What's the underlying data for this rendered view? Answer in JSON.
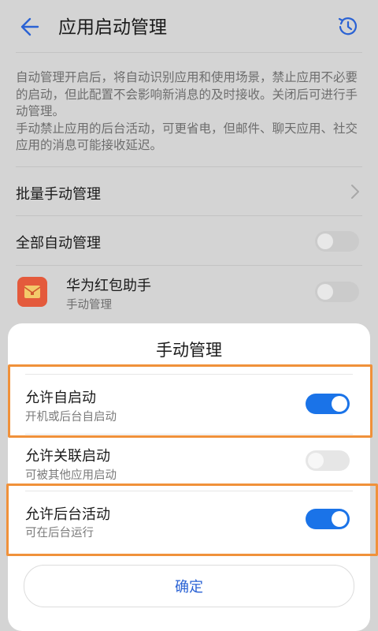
{
  "header": {
    "title": "应用启动管理",
    "back_icon": "back-arrow-icon",
    "history_icon": "history-clock-icon",
    "accent": "#2a62d4"
  },
  "description": {
    "paragraph1": "自动管理开启后，将自动识别应用和使用场景，禁止应用不必要的启动，但此配置不会影响新消息的及时接收。关闭后可进行手动管理。",
    "paragraph2": "手动禁止应用的后台活动，可更省电，但邮件、聊天应用、社交应用的消息可能接收延迟。"
  },
  "list": {
    "batch_manual": "批量手动管理",
    "auto_all": {
      "label": "全部自动管理",
      "on": false
    },
    "app": {
      "name": "华为红包助手",
      "status": "手动管理",
      "on": false,
      "icon": "red-envelope-icon"
    }
  },
  "sheet": {
    "title": "手动管理",
    "options": [
      {
        "title": "允许自启动",
        "subtitle": "开机或后台自启动",
        "on": true,
        "highlighted": true
      },
      {
        "title": "允许关联启动",
        "subtitle": "可被其他应用启动",
        "on": false,
        "highlighted": false
      },
      {
        "title": "允许后台活动",
        "subtitle": "可在后台运行",
        "on": true,
        "highlighted": true
      }
    ],
    "confirm_label": "确定"
  },
  "colors": {
    "toggle_on": "#1a73e8",
    "toggle_off": "#cfcfcf",
    "highlight_border": "#f0913a"
  }
}
